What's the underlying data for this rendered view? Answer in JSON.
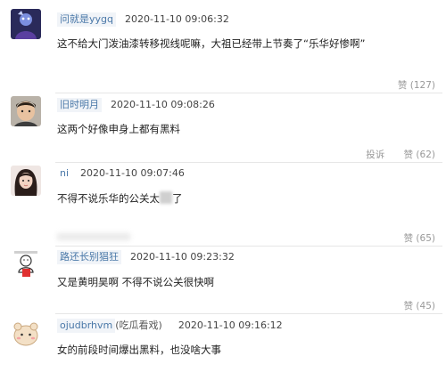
{
  "comments": [
    {
      "user": "问就是yygq",
      "tag": "",
      "time": "2020-11-10 09:06:32",
      "text": "这不给大门泼油漆转移视线呢嘛，大祖已经带上节奏了“乐华好惨啊”",
      "report": "",
      "likes": "赞 (127)"
    },
    {
      "user": "旧时明月",
      "tag": "",
      "time": "2020-11-10 09:08:26",
      "text": "这两个好像申身上都有黑料",
      "report": "投诉",
      "likes": "赞 (62)"
    },
    {
      "user": "ni",
      "tag": "",
      "time": "2020-11-10 09:07:46",
      "text_before": "不得不说乐华的公关太",
      "text_after": "了",
      "report": "",
      "likes": "赞 (65)"
    },
    {
      "user": "路还长别猖狂",
      "tag": "",
      "time": "2020-11-10 09:23:32",
      "text": "又是黄明昊啊 不得不说公关很快啊",
      "report": "",
      "likes": "赞 (45)"
    },
    {
      "user": "ojudbrhvm",
      "tag": "(吃瓜看戏)",
      "time": "2020-11-10 09:16:12",
      "text": "女的前段时间爆出黑料，也没啥大事",
      "report": "",
      "likes": "赞 (34)"
    }
  ],
  "colors": {
    "username": "#4a78a8",
    "meta": "#999999",
    "text": "#222222"
  },
  "icons": [
    "avatar-game-character",
    "avatar-boy-photo",
    "avatar-girl-photo",
    "avatar-cartoon-sign",
    "avatar-cartoon-hamster"
  ]
}
